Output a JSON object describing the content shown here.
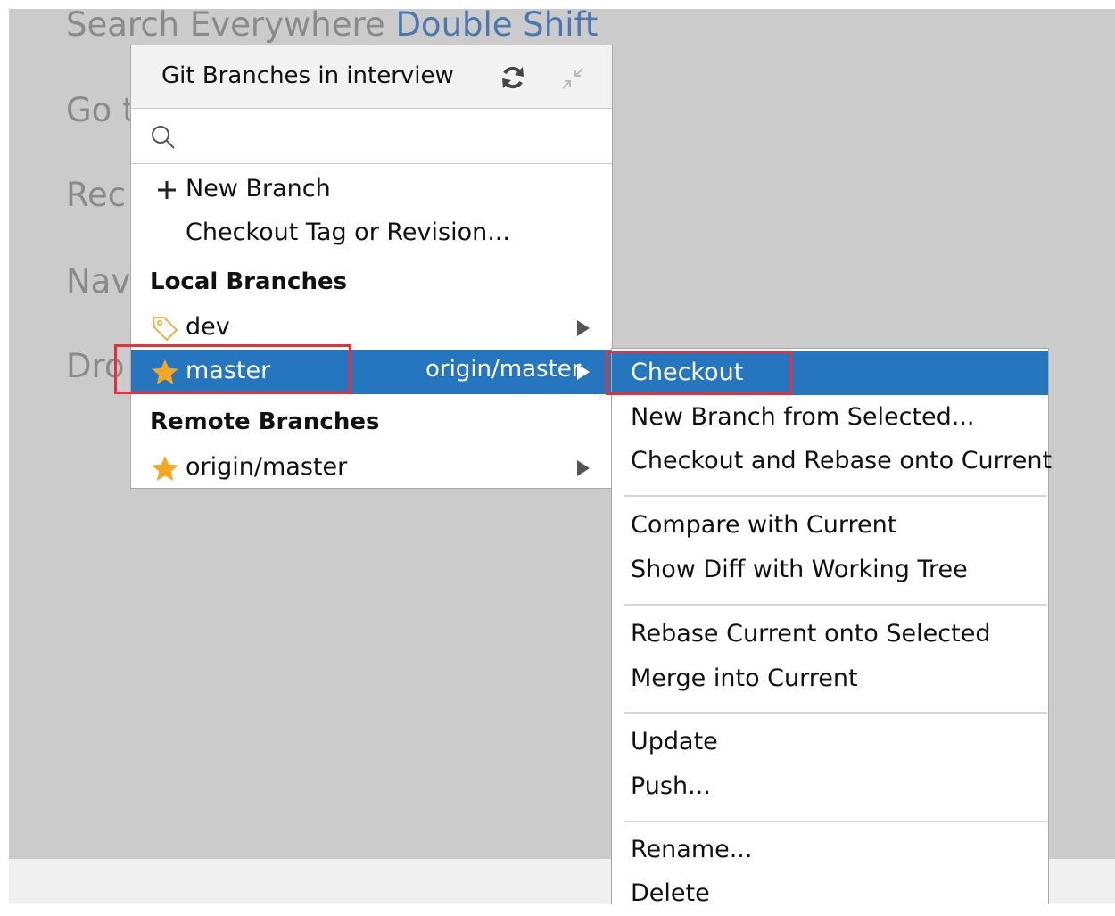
{
  "background_hints": [
    {
      "text": "Search Everywhere",
      "shortcut": "Double Shift"
    },
    {
      "text": "Go t",
      "shortcut": ""
    },
    {
      "text": "Rec",
      "shortcut": ""
    },
    {
      "text": "Nav",
      "shortcut": ""
    },
    {
      "text": "Dro",
      "shortcut": ""
    }
  ],
  "popup": {
    "title": "Git Branches in interview",
    "search_placeholder": "",
    "actions": {
      "new_branch": "New Branch",
      "checkout_tag": "Checkout Tag or Revision..."
    },
    "local_header": "Local Branches",
    "local_branches": [
      {
        "name": "dev",
        "icon": "tag-icon",
        "tracking": ""
      },
      {
        "name": "master",
        "icon": "star-icon",
        "tracking": "origin/master",
        "selected": true
      }
    ],
    "remote_header": "Remote Branches",
    "remote_branches": [
      {
        "name": "origin/master",
        "icon": "star-icon"
      }
    ]
  },
  "submenu": {
    "groups": [
      [
        "Checkout",
        "New Branch from Selected...",
        "Checkout and Rebase onto Current"
      ],
      [
        "Compare with Current",
        "Show Diff with Working Tree"
      ],
      [
        "Rebase Current onto Selected",
        "Merge into Current"
      ],
      [
        "Update",
        "Push..."
      ],
      [
        "Rename...",
        "Delete"
      ]
    ]
  },
  "colors": {
    "selection": "#2675bf",
    "highlight": "#e8303a",
    "star": "#f5a623",
    "tag": "#e8b450"
  }
}
